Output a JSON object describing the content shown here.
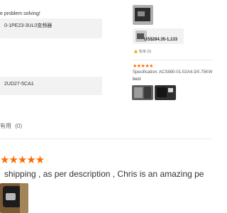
{
  "left_reviews": {
    "review1_text": "e problem solving!",
    "review1_spec": "0-1PE23-3UL0变频器",
    "review2_spec": "2UD27-5CA1"
  },
  "useful": {
    "label": "有用",
    "count": "(0)"
  },
  "main_review": {
    "stars": "★★★★★",
    "text": "shipping , as per description , Chris is an amazing pe"
  },
  "right_panel": {
    "price": "US$284.35-1,133",
    "like_label": "有用",
    "like_count": "(0)",
    "stars": "★★★★★",
    "spec": "Specification:  ACS880-01-02A4-3/0.75KW",
    "review_text": "best"
  },
  "colors": {
    "accent": "#ff6a00",
    "card_bg": "#f2f2f2"
  }
}
